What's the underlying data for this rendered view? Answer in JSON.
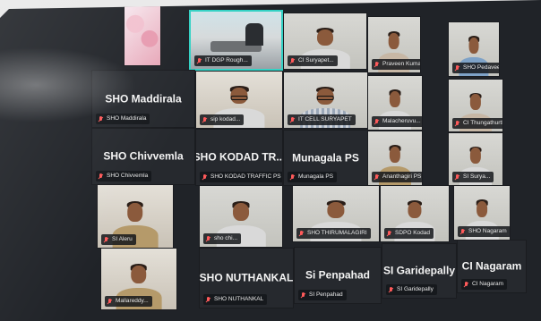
{
  "tiles": {
    "t_pink_left": {
      "label": "",
      "big": ""
    },
    "t_dgp": {
      "label": "IT DGP Rough...",
      "big": ""
    },
    "t_ci_suryapet": {
      "label": "CI Suryapet...",
      "big": ""
    },
    "t_praveen": {
      "label": "Praveen Kumar",
      "big": ""
    },
    "t_sho_pedaveedu": {
      "label": "SHO Pedaveedu",
      "big": ""
    },
    "t_sho_maddirala": {
      "label": "SHO Maddirala",
      "big": "SHO Maddirala"
    },
    "t_sip_kodad": {
      "label": "sip kodad...",
      "big": ""
    },
    "t_it_cell": {
      "label": "IT CELL SURYAPET",
      "big": ""
    },
    "t_malacheruvu": {
      "label": "Malacheruvu...",
      "big": ""
    },
    "t_ci_thungathurthi": {
      "label": "CI Thungathurthi",
      "big": ""
    },
    "t_sho_chivvemla": {
      "label": "SHO Chivvemla",
      "big": "SHO Chivvemla"
    },
    "t_sho_kodad_traffic": {
      "label": "SHO KODAD TRAFFIC PS",
      "big": "SHO KODAD TR..."
    },
    "t_munagala": {
      "label": "Munagala PS",
      "big": "Munagala PS"
    },
    "t_ananthagiri": {
      "label": "Ananthagiri PS",
      "big": ""
    },
    "t_si_suryapet": {
      "label": "SI Surya...",
      "big": ""
    },
    "t_si_aleru": {
      "label": "SI Aleru",
      "big": ""
    },
    "t_sho_chilk": {
      "label": "sho chi...",
      "big": ""
    },
    "t_sho_thirumalagiri": {
      "label": "SHO THIRUMALAGIRI",
      "big": ""
    },
    "t_sdpo_kodad": {
      "label": "SDPO Kodad",
      "big": ""
    },
    "t_sho_nagaram": {
      "label": "SHO Nagaram",
      "big": ""
    },
    "t_mallareddy": {
      "label": "Mallareddy...",
      "big": ""
    },
    "t_sho_nuthankal": {
      "label": "SHO NUTHANKAL",
      "big": "SHO NUTHANKAL"
    },
    "t_si_penpahad": {
      "label": "SI Penpahad",
      "big": "Si Penpahad"
    },
    "t_si_garidepally": {
      "label": "SI Garidepally",
      "big": "SI Garidepally"
    },
    "t_ci_nagaram": {
      "label": "CI Nagaram",
      "big": "CI Nagaram"
    }
  },
  "colors": {
    "active_border": "#33d1c4",
    "mic_muted": "#ff5a5a"
  }
}
